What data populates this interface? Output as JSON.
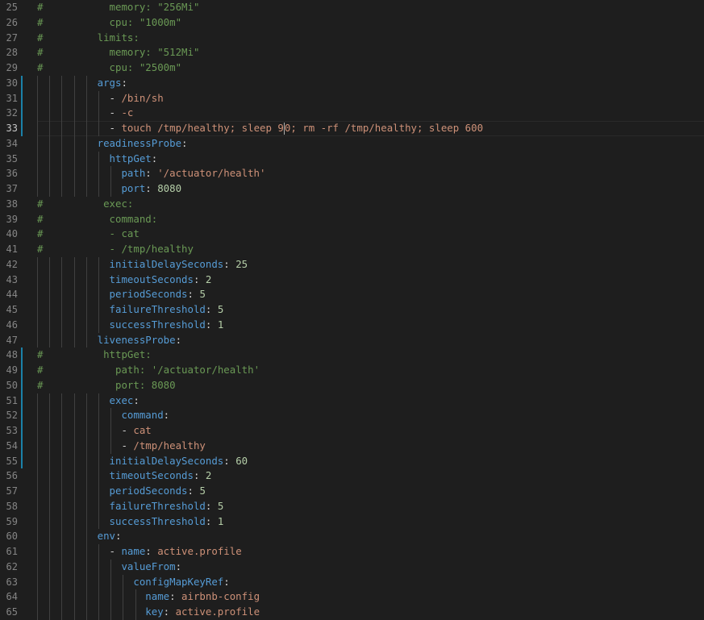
{
  "editor": {
    "cursor_line": 33,
    "lines": [
      {
        "no": "25",
        "comment": "#",
        "pad": "           ",
        "tokens": [
          {
            "t": "c",
            "v": "memory: \"256Mi\""
          }
        ]
      },
      {
        "no": "26",
        "comment": "#",
        "pad": "           ",
        "tokens": [
          {
            "t": "c",
            "v": "cpu: \"1000m\""
          }
        ]
      },
      {
        "no": "27",
        "comment": "#",
        "pad": "         ",
        "tokens": [
          {
            "t": "c",
            "v": "limits:"
          }
        ]
      },
      {
        "no": "28",
        "comment": "#",
        "pad": "           ",
        "tokens": [
          {
            "t": "c",
            "v": "memory: \"512Mi\""
          }
        ]
      },
      {
        "no": "29",
        "comment": "#",
        "pad": "           ",
        "tokens": [
          {
            "t": "c",
            "v": "cpu: \"2500m\""
          }
        ]
      },
      {
        "no": "30",
        "indent": 10,
        "bar": true,
        "tokens": [
          {
            "t": "k",
            "v": "args"
          },
          {
            "t": "p",
            "v": ":"
          }
        ]
      },
      {
        "no": "31",
        "indent": 12,
        "bar": true,
        "tokens": [
          {
            "t": "p",
            "v": "- "
          },
          {
            "t": "s",
            "v": "/bin/sh"
          }
        ]
      },
      {
        "no": "32",
        "indent": 12,
        "bar": true,
        "tokens": [
          {
            "t": "p",
            "v": "- "
          },
          {
            "t": "s",
            "v": "-c"
          }
        ]
      },
      {
        "no": "33",
        "indent": 12,
        "bar": true,
        "current": true,
        "tokens": [
          {
            "t": "p",
            "v": "- "
          },
          {
            "t": "s",
            "v": "touch /tmp/healthy; sleep 9"
          },
          {
            "t": "cursor",
            "v": ""
          },
          {
            "t": "s",
            "v": "0; rm -rf /tmp/healthy; sleep 600"
          }
        ]
      },
      {
        "no": "34",
        "indent": 10,
        "tokens": [
          {
            "t": "k",
            "v": "readinessProbe"
          },
          {
            "t": "p",
            "v": ":"
          }
        ]
      },
      {
        "no": "35",
        "indent": 12,
        "tokens": [
          {
            "t": "k",
            "v": "httpGet"
          },
          {
            "t": "p",
            "v": ":"
          }
        ]
      },
      {
        "no": "36",
        "indent": 14,
        "tokens": [
          {
            "t": "k",
            "v": "path"
          },
          {
            "t": "p",
            "v": ": "
          },
          {
            "t": "s",
            "v": "'/actuator/health'"
          }
        ]
      },
      {
        "no": "37",
        "indent": 14,
        "tokens": [
          {
            "t": "k",
            "v": "port"
          },
          {
            "t": "p",
            "v": ": "
          },
          {
            "t": "n",
            "v": "8080"
          }
        ]
      },
      {
        "no": "38",
        "comment": "#",
        "pad": "          ",
        "tokens": [
          {
            "t": "c",
            "v": "exec:"
          }
        ]
      },
      {
        "no": "39",
        "comment": "#",
        "pad": "           ",
        "tokens": [
          {
            "t": "c",
            "v": "command:"
          }
        ]
      },
      {
        "no": "40",
        "comment": "#",
        "pad": "           ",
        "tokens": [
          {
            "t": "c",
            "v": "- cat"
          }
        ]
      },
      {
        "no": "41",
        "comment": "#",
        "pad": "           ",
        "tokens": [
          {
            "t": "c",
            "v": "- /tmp/healthy"
          }
        ]
      },
      {
        "no": "42",
        "indent": 12,
        "tokens": [
          {
            "t": "k",
            "v": "initialDelaySeconds"
          },
          {
            "t": "p",
            "v": ": "
          },
          {
            "t": "n",
            "v": "25"
          }
        ]
      },
      {
        "no": "43",
        "indent": 12,
        "tokens": [
          {
            "t": "k",
            "v": "timeoutSeconds"
          },
          {
            "t": "p",
            "v": ": "
          },
          {
            "t": "n",
            "v": "2"
          }
        ]
      },
      {
        "no": "44",
        "indent": 12,
        "tokens": [
          {
            "t": "k",
            "v": "periodSeconds"
          },
          {
            "t": "p",
            "v": ": "
          },
          {
            "t": "n",
            "v": "5"
          }
        ]
      },
      {
        "no": "45",
        "indent": 12,
        "tokens": [
          {
            "t": "k",
            "v": "failureThreshold"
          },
          {
            "t": "p",
            "v": ": "
          },
          {
            "t": "n",
            "v": "5"
          }
        ]
      },
      {
        "no": "46",
        "indent": 12,
        "tokens": [
          {
            "t": "k",
            "v": "successThreshold"
          },
          {
            "t": "p",
            "v": ": "
          },
          {
            "t": "n",
            "v": "1"
          }
        ]
      },
      {
        "no": "47",
        "indent": 10,
        "tokens": [
          {
            "t": "k",
            "v": "livenessProbe"
          },
          {
            "t": "p",
            "v": ":"
          }
        ]
      },
      {
        "no": "48",
        "comment": "#",
        "pad": "          ",
        "bar": true,
        "tokens": [
          {
            "t": "c",
            "v": "httpGet:"
          }
        ]
      },
      {
        "no": "49",
        "comment": "#",
        "pad": "            ",
        "bar": true,
        "tokens": [
          {
            "t": "c",
            "v": "path: '/actuator/health'"
          }
        ]
      },
      {
        "no": "50",
        "comment": "#",
        "pad": "            ",
        "bar": true,
        "tokens": [
          {
            "t": "c",
            "v": "port: 8080"
          }
        ]
      },
      {
        "no": "51",
        "indent": 12,
        "bar": true,
        "tokens": [
          {
            "t": "k",
            "v": "exec"
          },
          {
            "t": "p",
            "v": ":"
          }
        ]
      },
      {
        "no": "52",
        "indent": 14,
        "bar": true,
        "tokens": [
          {
            "t": "k",
            "v": "command"
          },
          {
            "t": "p",
            "v": ":"
          }
        ]
      },
      {
        "no": "53",
        "indent": 14,
        "bar": true,
        "tokens": [
          {
            "t": "p",
            "v": "- "
          },
          {
            "t": "s",
            "v": "cat"
          }
        ]
      },
      {
        "no": "54",
        "indent": 14,
        "bar": true,
        "tokens": [
          {
            "t": "p",
            "v": "- "
          },
          {
            "t": "s",
            "v": "/tmp/healthy"
          }
        ]
      },
      {
        "no": "55",
        "indent": 12,
        "bar": true,
        "tokens": [
          {
            "t": "k",
            "v": "initialDelaySeconds"
          },
          {
            "t": "p",
            "v": ": "
          },
          {
            "t": "n",
            "v": "60"
          }
        ]
      },
      {
        "no": "56",
        "indent": 12,
        "tokens": [
          {
            "t": "k",
            "v": "timeoutSeconds"
          },
          {
            "t": "p",
            "v": ": "
          },
          {
            "t": "n",
            "v": "2"
          }
        ]
      },
      {
        "no": "57",
        "indent": 12,
        "tokens": [
          {
            "t": "k",
            "v": "periodSeconds"
          },
          {
            "t": "p",
            "v": ": "
          },
          {
            "t": "n",
            "v": "5"
          }
        ]
      },
      {
        "no": "58",
        "indent": 12,
        "tokens": [
          {
            "t": "k",
            "v": "failureThreshold"
          },
          {
            "t": "p",
            "v": ": "
          },
          {
            "t": "n",
            "v": "5"
          }
        ]
      },
      {
        "no": "59",
        "indent": 12,
        "tokens": [
          {
            "t": "k",
            "v": "successThreshold"
          },
          {
            "t": "p",
            "v": ": "
          },
          {
            "t": "n",
            "v": "1"
          }
        ]
      },
      {
        "no": "60",
        "indent": 10,
        "tokens": [
          {
            "t": "k",
            "v": "env"
          },
          {
            "t": "p",
            "v": ":"
          }
        ]
      },
      {
        "no": "61",
        "indent": 12,
        "tokens": [
          {
            "t": "p",
            "v": "- "
          },
          {
            "t": "k",
            "v": "name"
          },
          {
            "t": "p",
            "v": ": "
          },
          {
            "t": "s",
            "v": "active.profile"
          }
        ]
      },
      {
        "no": "62",
        "indent": 14,
        "tokens": [
          {
            "t": "k",
            "v": "valueFrom"
          },
          {
            "t": "p",
            "v": ":"
          }
        ]
      },
      {
        "no": "63",
        "indent": 16,
        "tokens": [
          {
            "t": "k",
            "v": "configMapKeyRef"
          },
          {
            "t": "p",
            "v": ":"
          }
        ]
      },
      {
        "no": "64",
        "indent": 18,
        "tokens": [
          {
            "t": "k",
            "v": "name"
          },
          {
            "t": "p",
            "v": ": "
          },
          {
            "t": "s",
            "v": "airbnb-config"
          }
        ]
      },
      {
        "no": "65",
        "indent": 18,
        "tokens": [
          {
            "t": "k",
            "v": "key"
          },
          {
            "t": "p",
            "v": ": "
          },
          {
            "t": "s",
            "v": "active.profile"
          }
        ]
      }
    ]
  }
}
